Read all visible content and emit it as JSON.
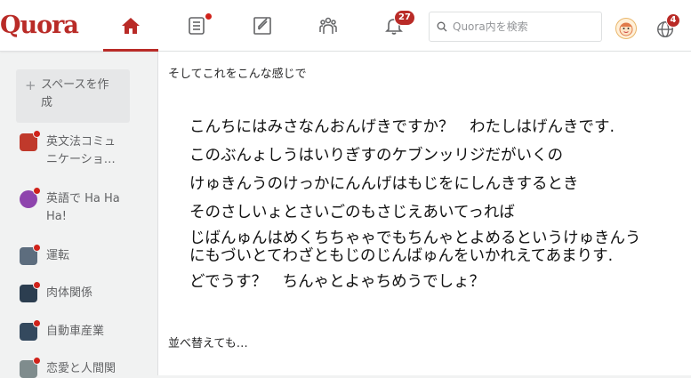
{
  "header": {
    "logo_text": "Quora",
    "notification_count": "27",
    "language_badge": "4",
    "search_placeholder": "Quora内を検索"
  },
  "sidebar": {
    "create_space_label": "スペースを作成",
    "create_space_line1": "スペースを作",
    "create_space_line2": "成",
    "items": [
      {
        "line1": "英文法コミュ",
        "line2": "ニケーショ…",
        "icon": "megaphone-icon"
      },
      {
        "line1": "英語で Ha Ha",
        "line2": "Ha!",
        "icon": "emoji-icon"
      },
      {
        "line1": "運転",
        "line2": "",
        "icon": "car-icon"
      },
      {
        "line1": "肉体関係",
        "line2": "",
        "icon": "document-icon"
      },
      {
        "line1": "自動車産業",
        "line2": "",
        "icon": "factory-icon"
      },
      {
        "line1": "恋愛と人間関",
        "line2": "",
        "icon": "people-icon"
      }
    ]
  },
  "post": {
    "intro": "そしてこれをこんな感じで",
    "lines": [
      "こんちにはみさなんおんげきですか？　わたしはげんきです.",
      "このぶんょしうはいりぎすのケブンッリジだがいくの",
      "けゅきんうのけっかにんんげはもじをにしんきするとき",
      "そのさしいょとさいごのもさじえあいてっれば",
      "じばんゅんはめくちちゃゃでもちんゃとよめるというけゅきんう",
      "にもづいとてわざともじのじんばゅんをいかれえてあまりす.",
      "どでうす？　ちんゃとよゃちめうでしょ？"
    ],
    "after": "並べ替えても…"
  },
  "colors": {
    "brand": "#b92b27",
    "badge": "#d0221a"
  }
}
